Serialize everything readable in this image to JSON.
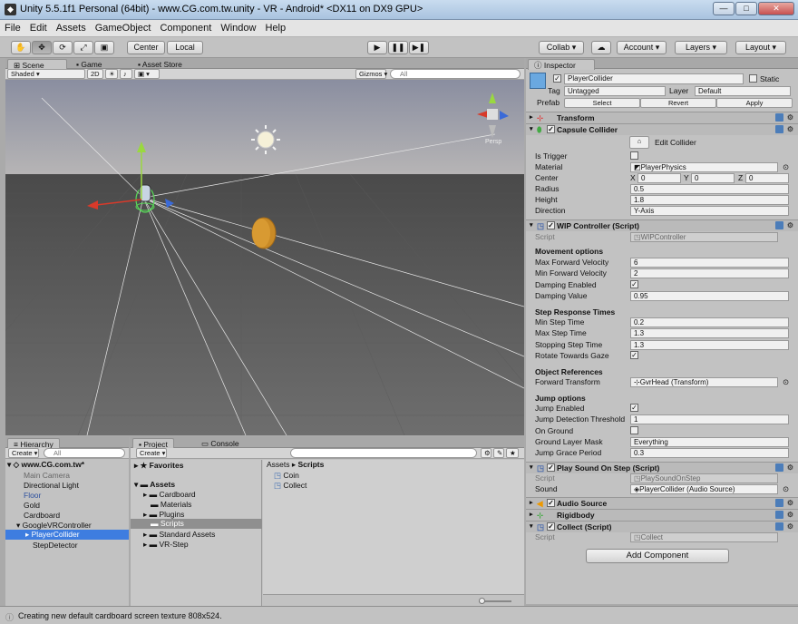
{
  "window": {
    "title": "Unity 5.5.1f1 Personal (64bit) - www.CG.com.tw.unity - VR - Android* <DX11 on DX9 GPU>",
    "minimize": "—",
    "maximize": "□",
    "close": "✕"
  },
  "menu": [
    "File",
    "Edit",
    "Assets",
    "GameObject",
    "Component",
    "Window",
    "Help"
  ],
  "toolbar": {
    "center": "Center",
    "local": "Local",
    "collab": "Collab ▾",
    "account": "Account",
    "layers": "Layers",
    "layout": "Layout"
  },
  "scene": {
    "tabs": [
      "Scene",
      "Game",
      "Asset Store"
    ],
    "shading": "Shaded",
    "mode_2d": "2D",
    "gizmos": "Gizmos ▾",
    "search_placeholder": "All",
    "persp": "Persp"
  },
  "hierarchy": {
    "tab": "Hierarchy",
    "create": "Create ▾",
    "search_placeholder": "All",
    "scene": "www.CG.com.tw*",
    "items": [
      "Main Camera",
      "Directional Light",
      "Floor",
      "Gold",
      "Cardboard",
      "GoogleVRController",
      "PlayerCollider",
      "StepDetector"
    ]
  },
  "project": {
    "tabs": [
      "Project",
      "Console"
    ],
    "create": "Create ▾",
    "favorites": "Favorites",
    "assets": "Assets",
    "folders": [
      "Cardboard",
      "Materials",
      "Plugins",
      "Scripts",
      "Standard Assets",
      "VR-Step"
    ],
    "breadcrumb": [
      "Assets",
      "Scripts"
    ],
    "files": [
      "Coin",
      "Collect"
    ]
  },
  "inspector": {
    "tab": "Inspector",
    "name": "PlayerCollider",
    "static": "Static",
    "tag_label": "Tag",
    "tag": "Untagged",
    "layer_label": "Layer",
    "layer": "Default",
    "prefab": "Prefab",
    "select": "Select",
    "revert": "Revert",
    "apply": "Apply",
    "transform": "Transform",
    "capsule": {
      "title": "Capsule Collider",
      "edit": "Edit Collider",
      "is_trigger": "Is Trigger",
      "material_label": "Material",
      "material": "PlayerPhysics",
      "center_label": "Center",
      "x": "0",
      "y": "0",
      "z": "0",
      "radius_label": "Radius",
      "radius": "0.5",
      "height_label": "Height",
      "height": "1.8",
      "direction_label": "Direction",
      "direction": "Y-Axis"
    },
    "wip": {
      "title": "WIP Controller (Script)",
      "script_label": "Script",
      "script": "WIPController",
      "movement": "Movement options",
      "max_fwd_label": "Max Forward Velocity",
      "max_fwd": "6",
      "min_fwd_label": "Min Forward Velocity",
      "min_fwd": "2",
      "damping_en_label": "Damping Enabled",
      "damping_val_label": "Damping Value",
      "damping_val": "0.95",
      "step": "Step Response Times",
      "min_step_label": "Min Step Time",
      "min_step": "0.2",
      "max_step_label": "Max Step Time",
      "max_step": "1.3",
      "stop_label": "Stopping Step Time",
      "stop": "1.3",
      "rotate_label": "Rotate Towards Gaze",
      "objref": "Object References",
      "fwd_tf_label": "Forward Transform",
      "fwd_tf": "GvrHead (Transform)",
      "jump": "Jump options",
      "jump_en_label": "Jump Enabled",
      "jump_thr_label": "Jump Detection Threshold",
      "jump_thr": "1",
      "on_ground_label": "On Ground",
      "mask_label": "Ground Layer Mask",
      "mask": "Everything",
      "grace_label": "Jump Grace Period",
      "grace": "0.3"
    },
    "sound": {
      "title": "Play Sound On Step (Script)",
      "script_label": "Script",
      "script": "PlaySoundOnStep",
      "sound_label": "Sound",
      "sound": "PlayerCollider (Audio Source)"
    },
    "audio": "Audio Source",
    "rigid": "Rigidbody",
    "collect": {
      "title": "Collect (Script)",
      "script_label": "Script",
      "script": "Collect"
    },
    "add": "Add Component"
  },
  "status": "Creating new default cardboard screen texture 808x524."
}
